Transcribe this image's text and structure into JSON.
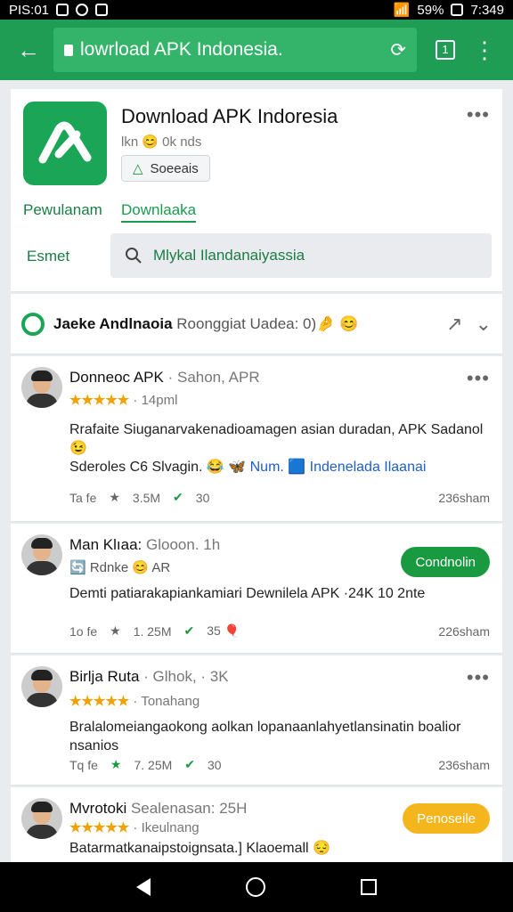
{
  "status_bar": {
    "left_text": "PIS:01",
    "battery": "59%",
    "time": "7:349"
  },
  "browser": {
    "url_text": "lowrload APK Indonesia.",
    "tab_icon_label": "1"
  },
  "app": {
    "title": "Download APK Indoresia",
    "subtitle": "lkn 😊 0k nds",
    "chip_label": "Soeeais",
    "tab_left": "Pewulanam",
    "tab_right": "Downlaaka",
    "search_label": "Esmet",
    "search_text": "Mlykal Ilandanaiyassia"
  },
  "discussion": {
    "title": "Jaeke Andlnaoia",
    "subtitle": "Roonggiat Uadea: 0)🤌 😊"
  },
  "posts": [
    {
      "name": "Donneoc APK",
      "source": "· Sahon, APR",
      "stars": "★★★★★",
      "rating_time": "· 14pml",
      "body1": "Rrafaite Siuganarvakenadioamagen asian duradan, APK Sadanol 😉",
      "body2_prefix": "Sderoles C6 Slvagin. 😂 🦋",
      "body2_link": "Num. 🟦 Indenelada Ilaanai",
      "meta_label": "Ta fe",
      "meta_likes": "3.5M",
      "meta_shares": "30",
      "time": "236sham"
    },
    {
      "name": "Man Klıaa:",
      "source": "Glooon. 1h",
      "sub": "🔄 Rdnke 😊 AR",
      "action": "Condnolin",
      "body1": "Demti patiarakapiankamiari Dewnilela APK ·24K 10 2nte",
      "meta_label": "1o fe",
      "meta_likes": "1. 25M",
      "meta_shares": "35 🎈",
      "time": "226sham"
    },
    {
      "name": "Birlja Ruta",
      "source": "· Glhok, · 3K",
      "stars": "★★★★★",
      "rating_time": "· Tonahang",
      "body1": "Bralalomeiangaokong aolkan lopanaanlahyetlansinatin boalior nsanios",
      "meta_label": "Tq fe",
      "meta_likes": "7. 25M",
      "meta_shares": "30",
      "time": "236sham"
    },
    {
      "name": "Mvrotoki",
      "source": "Sealenasan: 25H",
      "stars": "★★★★★",
      "rating_time": "· Ikeulnang",
      "action": "Penoseile",
      "body1": "Batarmatkanaipstoignsata.] Klaoemall 😔"
    }
  ]
}
